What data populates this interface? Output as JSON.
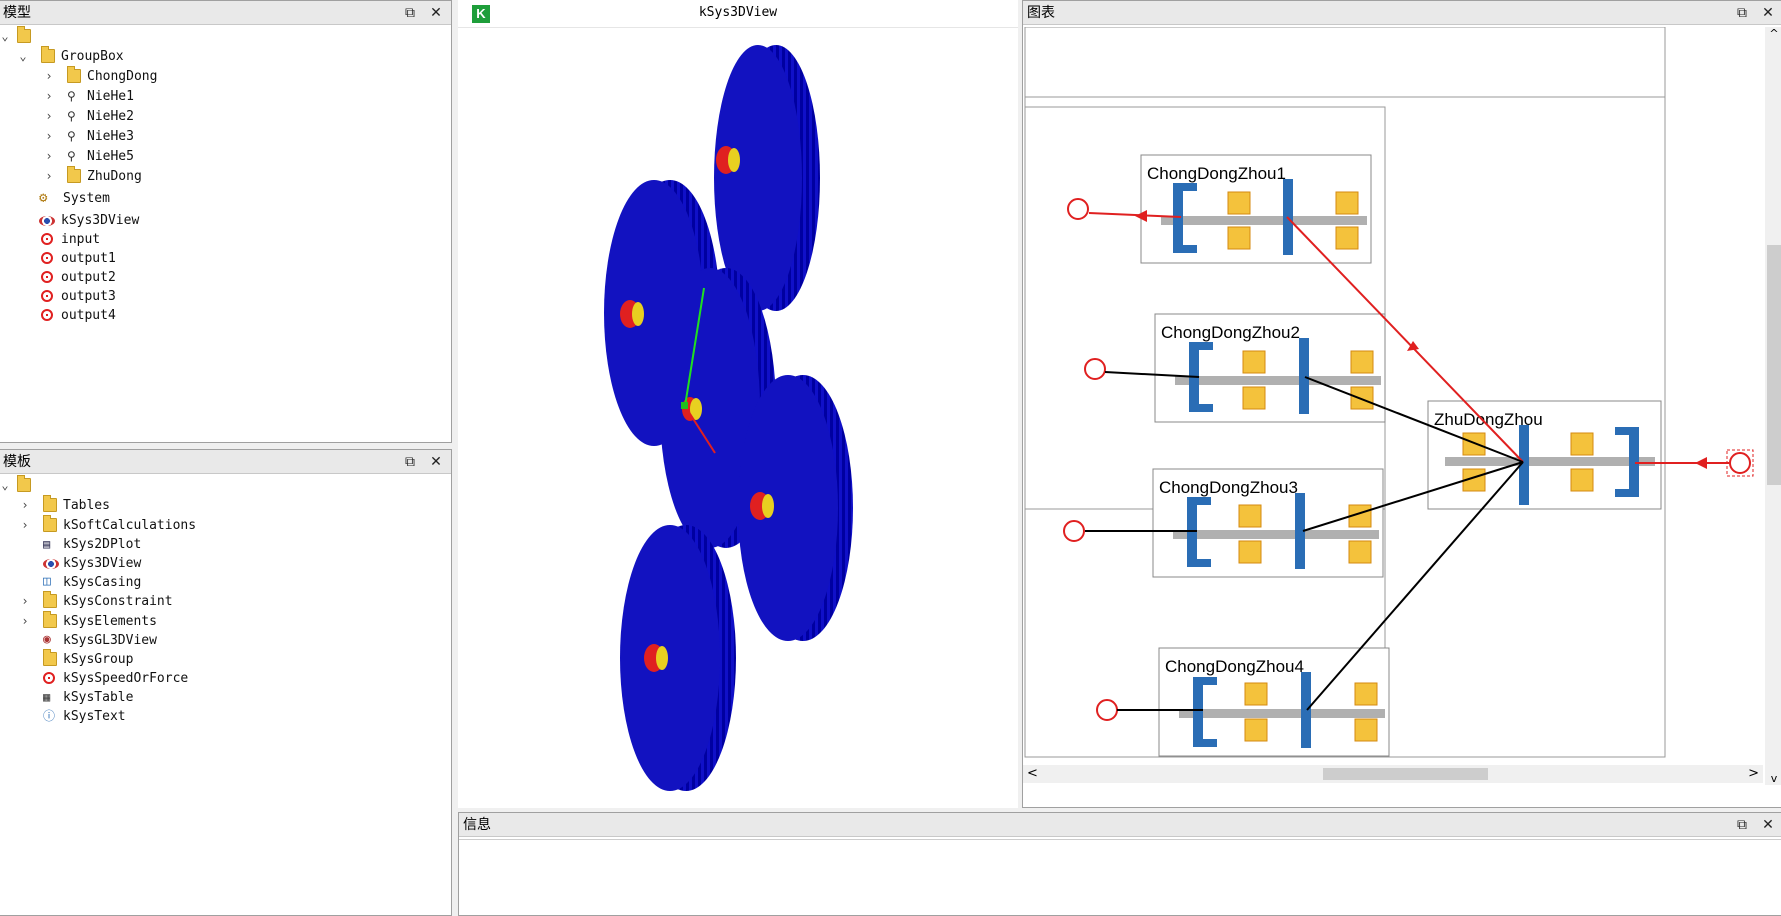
{
  "model_panel": {
    "title": "模型",
    "items": [
      {
        "label": "",
        "icon": "folder-open-icon"
      },
      {
        "label": "GroupBox",
        "icon": "folder-icon"
      },
      {
        "label": "ChongDong",
        "icon": "folder-icon"
      },
      {
        "label": "NieHe1",
        "icon": "mesh-icon"
      },
      {
        "label": "NieHe2",
        "icon": "mesh-icon"
      },
      {
        "label": "NieHe3",
        "icon": "mesh-icon"
      },
      {
        "label": "NieHe5",
        "icon": "mesh-icon"
      },
      {
        "label": "ZhuDong",
        "icon": "folder-icon"
      },
      {
        "label": "System",
        "icon": "system-icon"
      },
      {
        "label": "kSys3DView",
        "icon": "eye-icon"
      },
      {
        "label": "input",
        "icon": "speed-icon"
      },
      {
        "label": "output1",
        "icon": "speed-icon"
      },
      {
        "label": "output2",
        "icon": "speed-icon"
      },
      {
        "label": "output3",
        "icon": "speed-icon"
      },
      {
        "label": "output4",
        "icon": "speed-icon"
      }
    ]
  },
  "template_panel": {
    "title": "模板",
    "items": [
      {
        "label": "",
        "icon": "folder-open-icon"
      },
      {
        "label": "Tables",
        "icon": "folder-icon"
      },
      {
        "label": "kSoftCalculations",
        "icon": "folder-icon"
      },
      {
        "label": "kSys2DPlot",
        "icon": "plot-icon"
      },
      {
        "label": "kSys3DView",
        "icon": "eye-icon"
      },
      {
        "label": "kSysCasing",
        "icon": "cube-icon"
      },
      {
        "label": "kSysConstraint",
        "icon": "folder-icon"
      },
      {
        "label": "kSysElements",
        "icon": "folder-icon"
      },
      {
        "label": "kSysGL3DView",
        "icon": "gl-icon"
      },
      {
        "label": "kSysGroup",
        "icon": "folder-icon"
      },
      {
        "label": "kSysSpeedOrForce",
        "icon": "speed-icon"
      },
      {
        "label": "kSysTable",
        "icon": "table-icon"
      },
      {
        "label": "kSysText",
        "icon": "info-icon"
      }
    ]
  },
  "view3d": {
    "title": "kSys3DView",
    "logo": "K",
    "gear_color": "#1010c8"
  },
  "diagram_panel": {
    "title": "图表",
    "shafts": [
      {
        "label": "ChongDongZhou1"
      },
      {
        "label": "ChongDongZhou2"
      },
      {
        "label": "ChongDongZhou3"
      },
      {
        "label": "ChongDongZhou4"
      },
      {
        "label": "ZhuDongZhou"
      }
    ],
    "scroll_left": "<",
    "scroll_right": ">",
    "scroll_up": "^",
    "scroll_down": "v"
  },
  "info_panel": {
    "title": "信息"
  },
  "window_buttons": {
    "float": "⧉",
    "close": "✕"
  },
  "colors": {
    "accent_red": "#e02020",
    "shaft_blue": "#2a6db5",
    "bearing": "#f0a820"
  }
}
